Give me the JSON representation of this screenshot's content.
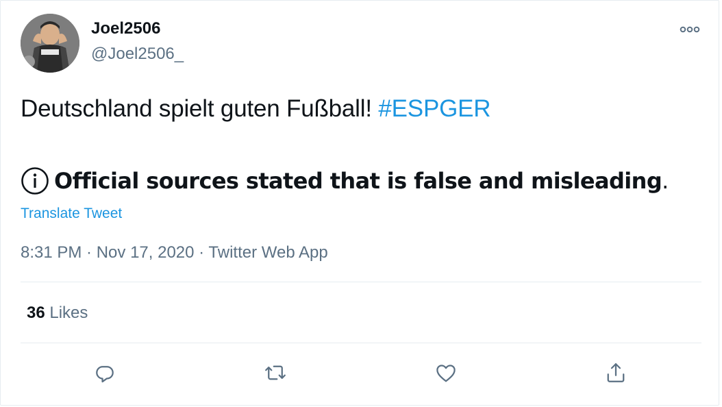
{
  "author": {
    "display_name": "Joel2506",
    "handle": "@Joel2506_",
    "avatar_icon": "profile-photo"
  },
  "tweet": {
    "text": "Deutschland spielt guten Fußball! ",
    "hashtag": "#ESPGER",
    "notice_icon": "info-circle-icon",
    "notice_text": "Official sources stated that is false and misleading",
    "notice_period": ".",
    "translate_label": "Translate Tweet"
  },
  "meta": {
    "time": "8:31 PM",
    "separator1": " · ",
    "date": "Nov 17, 2020",
    "separator2": " · ",
    "source": "Twitter Web App"
  },
  "stats": {
    "likes_count": "36",
    "likes_label": " Likes"
  },
  "actions": [
    "reply-icon",
    "retweet-icon",
    "like-icon",
    "share-icon"
  ],
  "colors": {
    "text": "#0f1419",
    "secondary": "#5b7083",
    "link": "#1b95e0",
    "border": "#e6ecf0"
  }
}
